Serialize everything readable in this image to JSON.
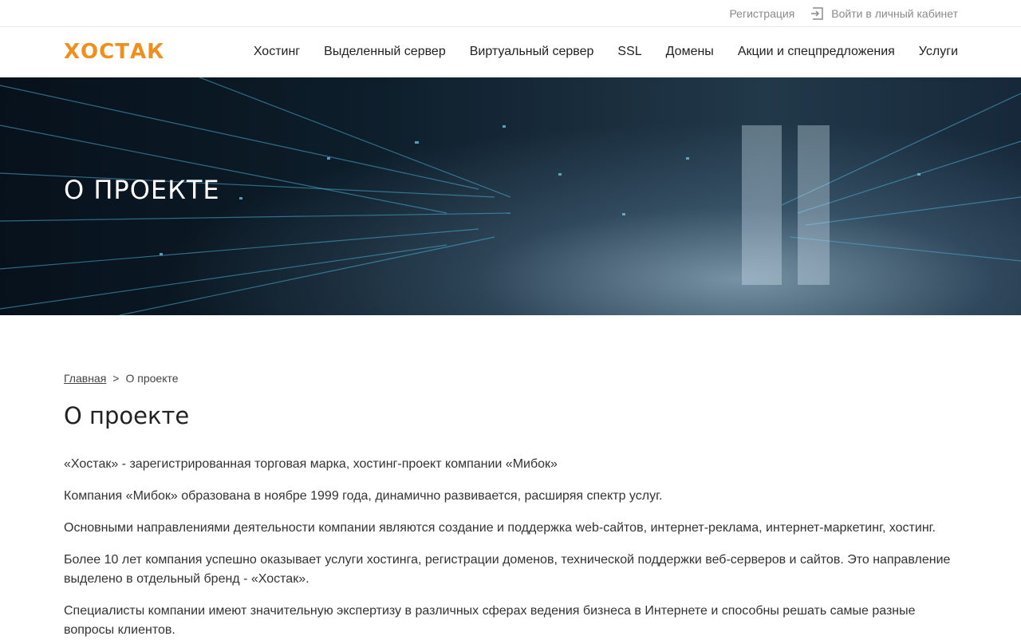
{
  "topbar": {
    "register": "Регистрация",
    "login": "Войти в личный кабинет"
  },
  "brand": {
    "logo": "ХОСТАК",
    "accent_color": "#ee8f1e"
  },
  "menu": {
    "items": [
      {
        "label": "Хостинг"
      },
      {
        "label": "Выделенный сервер"
      },
      {
        "label": "Виртуальный сервер"
      },
      {
        "label": "SSL"
      },
      {
        "label": "Домены"
      },
      {
        "label": "Акции и спецпредложения"
      },
      {
        "label": "Услуги"
      }
    ]
  },
  "hero": {
    "title": "О ПРОЕКТЕ"
  },
  "breadcrumb": {
    "home": "Главная",
    "separator": ">",
    "current": "О проекте"
  },
  "page": {
    "title": "О проекте",
    "paragraphs": [
      "«Хостак» - зарегистрированная торговая марка, хостинг-проект компании «Мибок»",
      "Компания «Мибок» образована в ноябре 1999 года, динамично развивается, расширяя спектр услуг.",
      "Основными направлениями деятельности компании являются создание и поддержка web-сайтов, интернет-реклама, интернет-маркетинг, хостинг.",
      "Более 10 лет компания успешно оказывает услуги хостинга, регистрации доменов, технической поддержки веб-серверов и сайтов. Это направление выделено в отдельный бренд - «Хостак».",
      "Специалисты компании имеют значительную экспертизу в различных сферах ведения бизнеса в Интернете и способны решать самые разные вопросы клиентов."
    ]
  }
}
